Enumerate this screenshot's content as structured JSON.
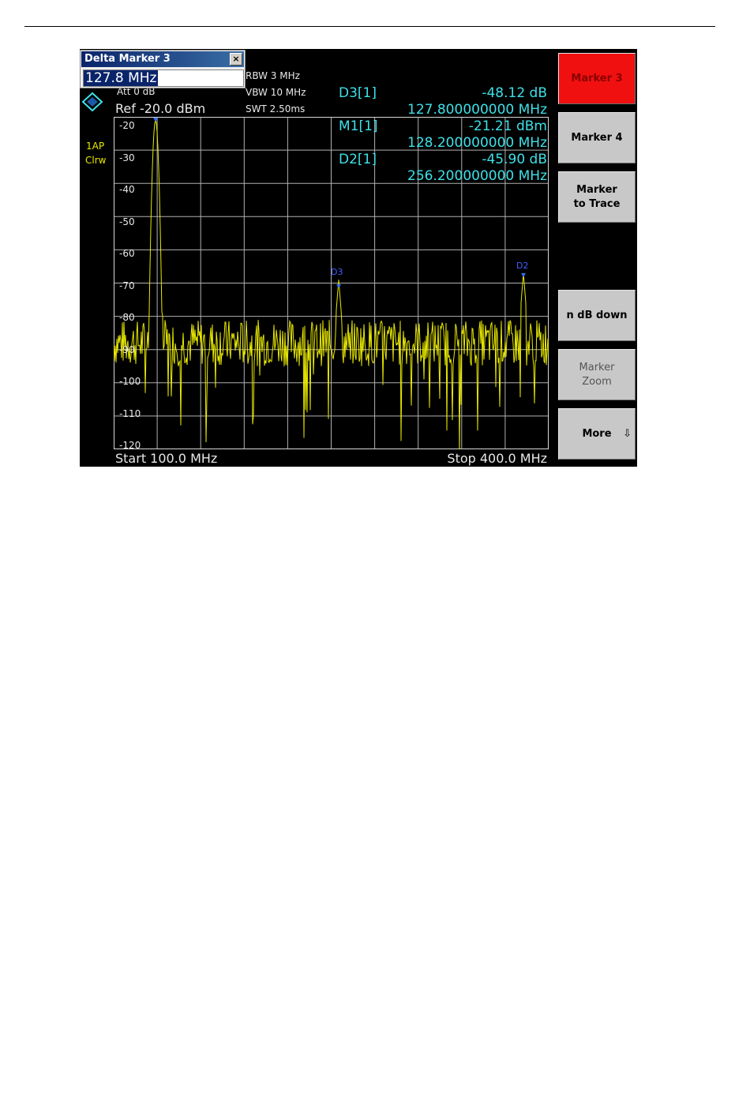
{
  "dialog": {
    "title": "Delta Marker 3",
    "close": "×",
    "value": "127.8 MHz"
  },
  "settings": {
    "rbw": "RBW  3 MHz",
    "vbw": "VBW  10 MHz",
    "swt": "SWT  2.50ms",
    "att": "Att   0 dB",
    "ref": "Ref -20.0 dBm",
    "trace_mode": "1AP",
    "trace_detector": "Clrw"
  },
  "markers": [
    {
      "label": "D3[1]",
      "level": "-48.12 dB",
      "freq": "127.800000000 MHz"
    },
    {
      "label": "M1[1]",
      "level": "-21.21 dBm",
      "freq": "128.200000000 MHz"
    },
    {
      "label": "D2[1]",
      "level": "-45.90 dB",
      "freq": "256.200000000 MHz"
    }
  ],
  "plot": {
    "y_labels": [
      "-20",
      "-30",
      "-40",
      "-50",
      "-60",
      "-70",
      "-80",
      "-90",
      "-100",
      "-110",
      "-120"
    ],
    "start": "Start 100.0 MHz",
    "stop": "Stop 400.0 MHz",
    "marker_tags": {
      "d3": "D3",
      "d2": "D2"
    }
  },
  "softkeys": [
    {
      "label": "Marker 3",
      "state": "active"
    },
    {
      "label": "Marker 4",
      "state": "normal"
    },
    {
      "label": "Marker to Trace",
      "state": "normal"
    },
    {
      "label": "n dB down",
      "state": "normal"
    },
    {
      "label": "Marker Zoom",
      "state": "dim"
    },
    {
      "label": "More",
      "state": "normal",
      "arrow": "⇩"
    }
  ],
  "colors": {
    "trace": "#e8e800",
    "marker_text": "#3ee0e8",
    "active_key": "#f01010"
  }
}
